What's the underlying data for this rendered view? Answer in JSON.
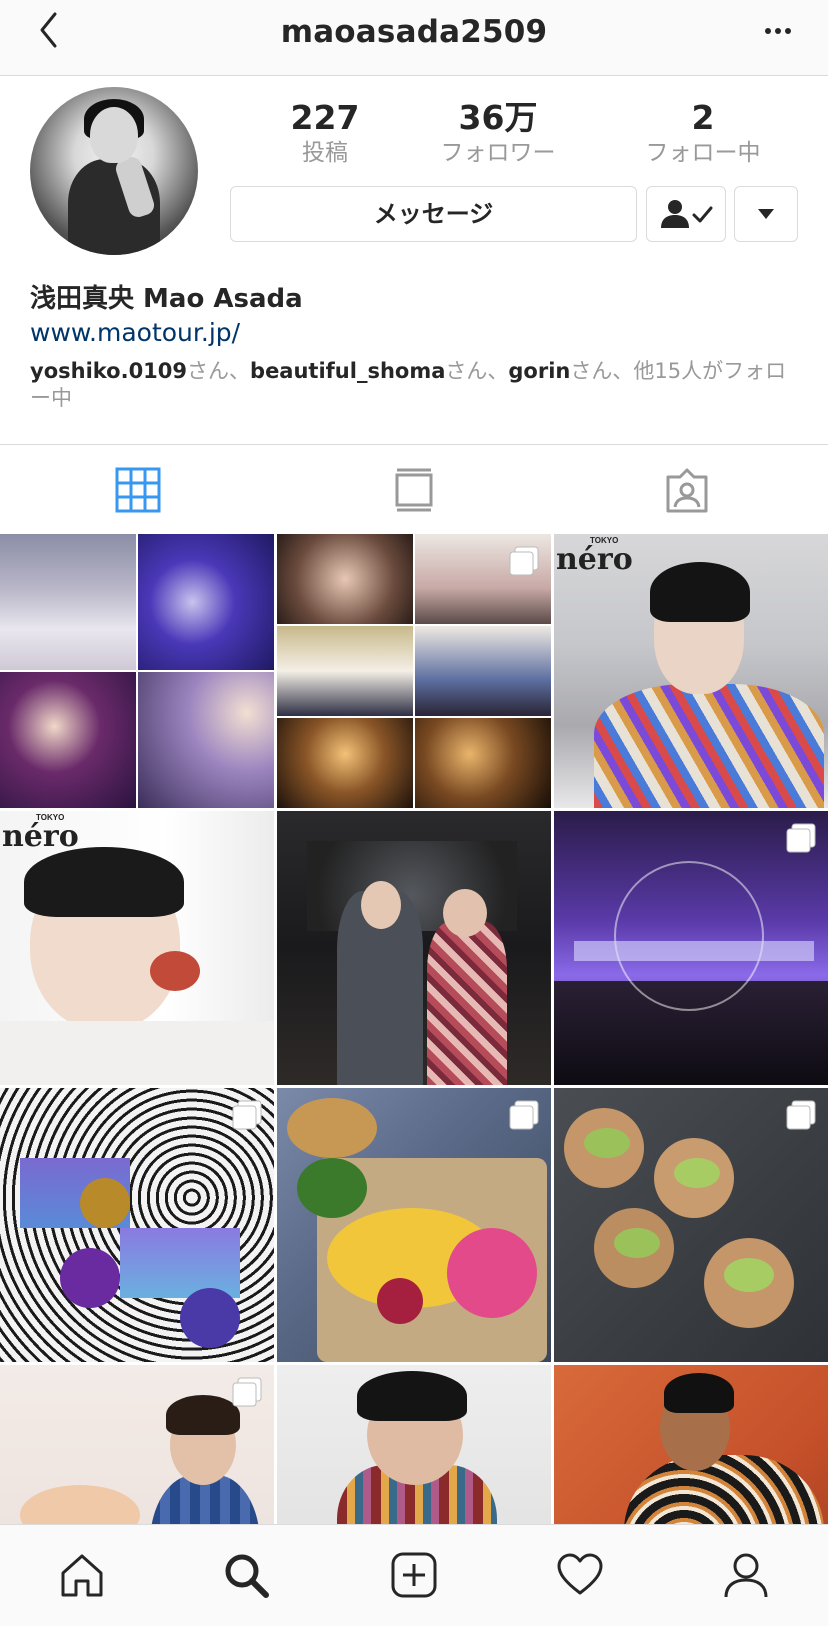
{
  "header": {
    "username": "maoasada2509",
    "back_icon": "chevron-left-icon",
    "more_icon": "more-horizontal-icon"
  },
  "profile": {
    "stats": [
      {
        "num": "227",
        "label": "投稿"
      },
      {
        "num": "36万",
        "label": "フォロワー"
      },
      {
        "num": "2",
        "label": "フォロー中"
      }
    ],
    "message_label": "メッセージ",
    "full_name": "浅田真央 Mao Asada",
    "website": "www.maotour.jp/",
    "followed_by": {
      "user1": "yoshiko.0109",
      "suffix1": "さん、",
      "user2": "beautiful_shoma",
      "suffix2": "さん、",
      "user3": "gorin",
      "suffix3": "さん、他15人がフォロー中"
    }
  },
  "tabs": [
    {
      "name": "grid-icon",
      "active": true
    },
    {
      "name": "feed-icon",
      "active": false
    },
    {
      "name": "tagged-icon",
      "active": false
    }
  ],
  "grid": {
    "nero_label": "néro",
    "nero_small": "TOKYO"
  },
  "colors": {
    "accent": "#3897f0",
    "link": "#003569",
    "border": "#dbdbdb",
    "muted": "#999999"
  },
  "bottom_nav": [
    "home-icon",
    "search-icon",
    "add-post-icon",
    "activity-heart-icon",
    "profile-icon"
  ]
}
